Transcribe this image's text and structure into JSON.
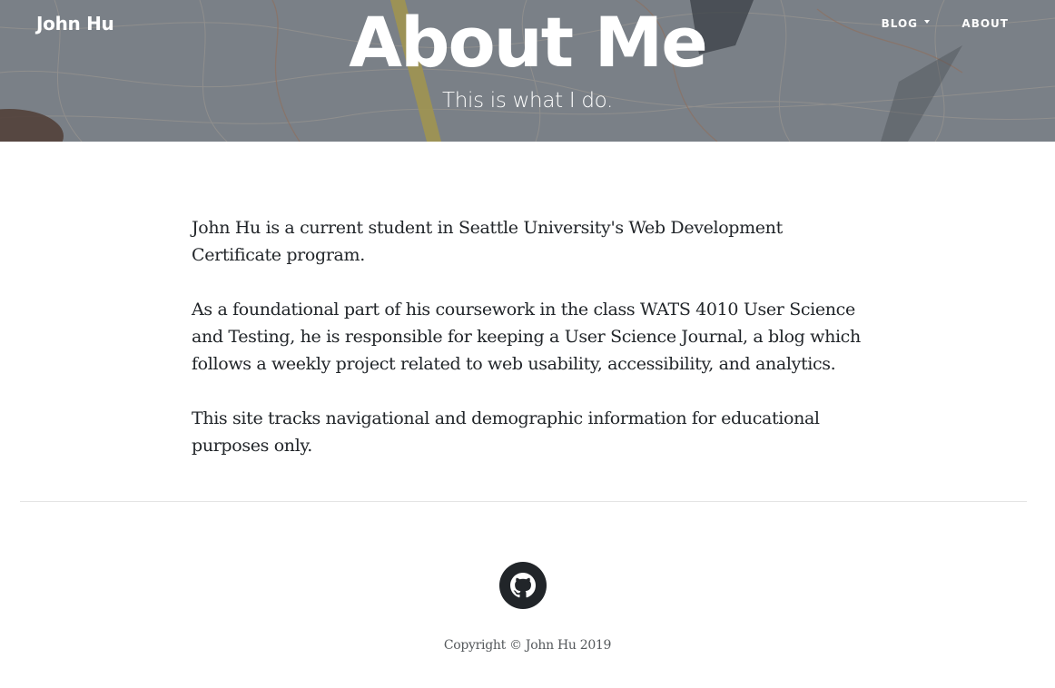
{
  "navbar": {
    "brand": "John Hu",
    "items": [
      {
        "label": "BLOG",
        "has_dropdown": true
      },
      {
        "label": "ABOUT",
        "has_dropdown": false
      }
    ]
  },
  "header": {
    "title": "About Me",
    "subtitle": "This is what I do."
  },
  "main": {
    "paragraphs": [
      "John Hu is a current student in Seattle University's Web Development Certificate program.",
      "As a foundational part of his coursework in the class WATS 4010 User Science and Testing, he is responsible for keeping a User Science Journal, a blog which follows a weekly project related to web usability, accessibility, and analytics.",
      "This site tracks navigational and demographic information for educational purposes only."
    ]
  },
  "footer": {
    "social_icon": "github-icon",
    "copyright": "Copyright © John Hu 2019"
  },
  "colors": {
    "text": "#212529",
    "footer_icon_bg": "#212529",
    "divider": "#e4e4e4"
  }
}
